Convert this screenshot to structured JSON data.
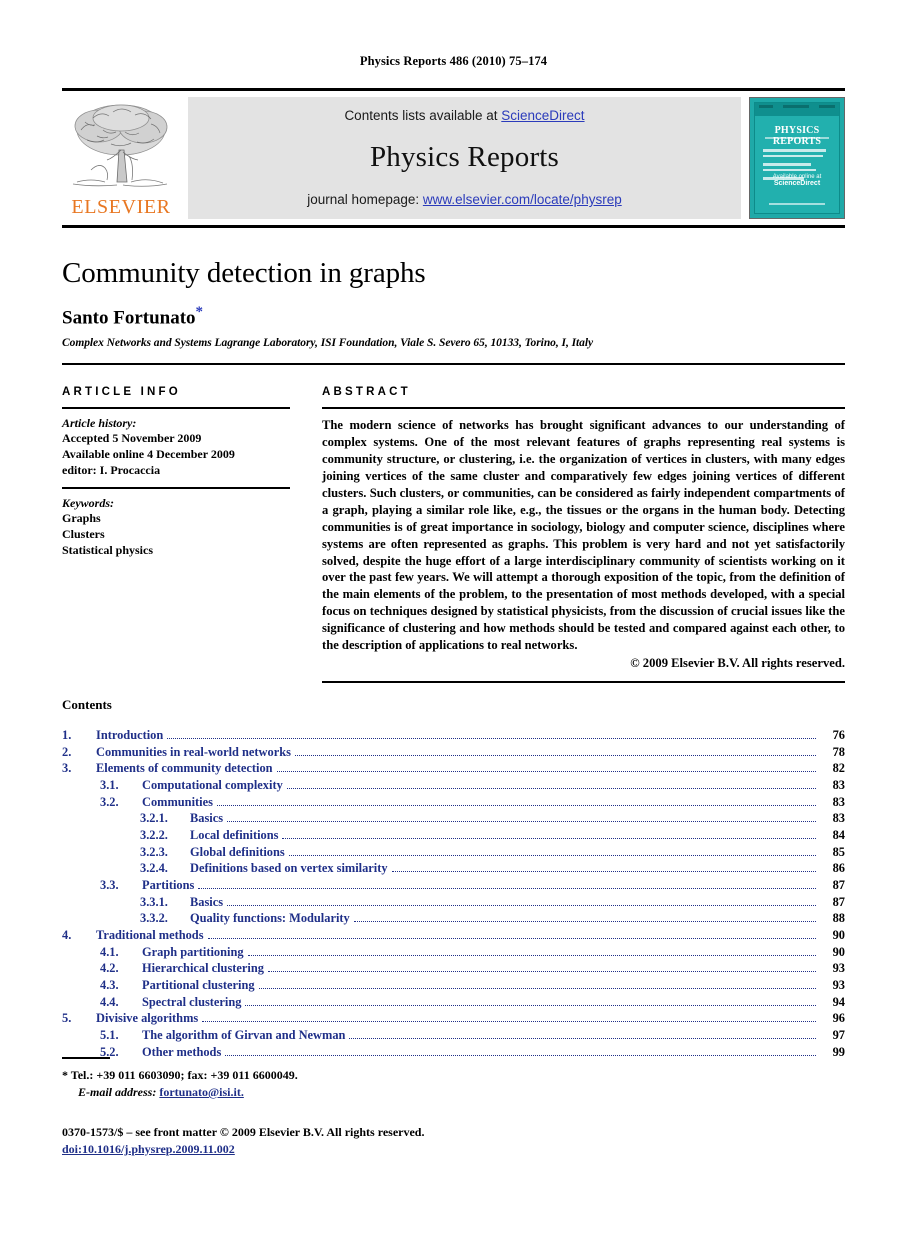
{
  "running_head": "Physics Reports 486 (2010) 75–174",
  "masthead": {
    "publisher_wordmark": "ELSEVIER",
    "contents_prefix": "Contents lists available at ",
    "contents_link": "ScienceDirect",
    "journal_name": "Physics Reports",
    "homepage_prefix": "journal homepage: ",
    "homepage_link": "www.elsevier.com/locate/physrep",
    "cover": {
      "title": "PHYSICS REPORTS",
      "sciencedirect_label": "ScienceDirect",
      "sciencedirect_avail": "Available online at",
      "accent_color": "#22b0ae"
    },
    "brand_orange": "#E87722",
    "link_blue": "#2b3bbb"
  },
  "title_block": {
    "title": "Community detection in graphs",
    "author": "Santo Fortunato",
    "author_mark": "*",
    "affiliation": "Complex Networks and Systems Lagrange Laboratory, ISI Foundation, Viale S. Severo 65, 10133, Torino, I, Italy"
  },
  "article_info": {
    "heading": "ARTICLE INFO",
    "history_label": "Article history:",
    "history_lines": [
      "Accepted 5 November 2009",
      "Available online 4 December 2009",
      "editor: I. Procaccia"
    ],
    "keywords_label": "Keywords:",
    "keywords": [
      "Graphs",
      "Clusters",
      "Statistical physics"
    ]
  },
  "abstract": {
    "heading": "ABSTRACT",
    "body": "The modern science of networks has brought significant advances to our understanding of complex systems. One of the most relevant features of graphs representing real systems is community structure, or clustering, i.e. the organization of vertices in clusters, with many edges joining vertices of the same cluster and comparatively few edges joining vertices of different clusters. Such clusters, or communities, can be considered as fairly independent compartments of a graph, playing a similar role like, e.g., the tissues or the organs in the human body. Detecting communities is of great importance in sociology, biology and computer science, disciplines where systems are often represented as graphs. This problem is very hard and not yet satisfactorily solved, despite the huge effort of a large interdisciplinary community of scientists working on it over the past few years. We will attempt a thorough exposition of the topic, from the definition of the main elements of the problem, to the presentation of most methods developed, with a special focus on techniques designed by statistical physicists, from the discussion of crucial issues like the significance of clustering and how methods should be tested and compared against each other, to the description of applications to real networks.",
    "copyright": "© 2009 Elsevier B.V. All rights reserved."
  },
  "contents": {
    "heading": "Contents",
    "entries": [
      {
        "level": 1,
        "number": "1.",
        "label": "Introduction",
        "page": "76"
      },
      {
        "level": 1,
        "number": "2.",
        "label": "Communities in real-world networks",
        "page": "78"
      },
      {
        "level": 1,
        "number": "3.",
        "label": "Elements of community detection",
        "page": "82"
      },
      {
        "level": 2,
        "number": "3.1.",
        "label": "Computational complexity",
        "page": "83"
      },
      {
        "level": 2,
        "number": "3.2.",
        "label": "Communities",
        "page": "83"
      },
      {
        "level": 3,
        "number": "3.2.1.",
        "label": "Basics",
        "page": "83"
      },
      {
        "level": 3,
        "number": "3.2.2.",
        "label": "Local definitions",
        "page": "84"
      },
      {
        "level": 3,
        "number": "3.2.3.",
        "label": "Global definitions",
        "page": "85"
      },
      {
        "level": 3,
        "number": "3.2.4.",
        "label": "Definitions based on vertex similarity",
        "page": "86"
      },
      {
        "level": 2,
        "number": "3.3.",
        "label": "Partitions",
        "page": "87"
      },
      {
        "level": 3,
        "number": "3.3.1.",
        "label": "Basics",
        "page": "87"
      },
      {
        "level": 3,
        "number": "3.3.2.",
        "label": "Quality functions: Modularity",
        "page": "88"
      },
      {
        "level": 1,
        "number": "4.",
        "label": "Traditional methods",
        "page": "90"
      },
      {
        "level": 2,
        "number": "4.1.",
        "label": "Graph partitioning",
        "page": "90"
      },
      {
        "level": 2,
        "number": "4.2.",
        "label": "Hierarchical clustering",
        "page": "93"
      },
      {
        "level": 2,
        "number": "4.3.",
        "label": "Partitional clustering",
        "page": "93"
      },
      {
        "level": 2,
        "number": "4.4.",
        "label": "Spectral clustering",
        "page": "94"
      },
      {
        "level": 1,
        "number": "5.",
        "label": "Divisive algorithms",
        "page": "96"
      },
      {
        "level": 2,
        "number": "5.1.",
        "label": "The algorithm of Girvan and Newman",
        "page": "97"
      },
      {
        "level": 2,
        "number": "5.2.",
        "label": "Other methods",
        "page": "99"
      }
    ]
  },
  "footnotes": {
    "star": "*",
    "tel_fax": "Tel.: +39 011 6603090; fax: +39 011 6600049.",
    "email_label": "E-mail address:",
    "email": "fortunato@isi.it."
  },
  "imprint": {
    "line1": "0370-1573/$ – see front matter © 2009 Elsevier B.V. All rights reserved.",
    "doi": "doi:10.1016/j.physrep.2009.11.002"
  }
}
